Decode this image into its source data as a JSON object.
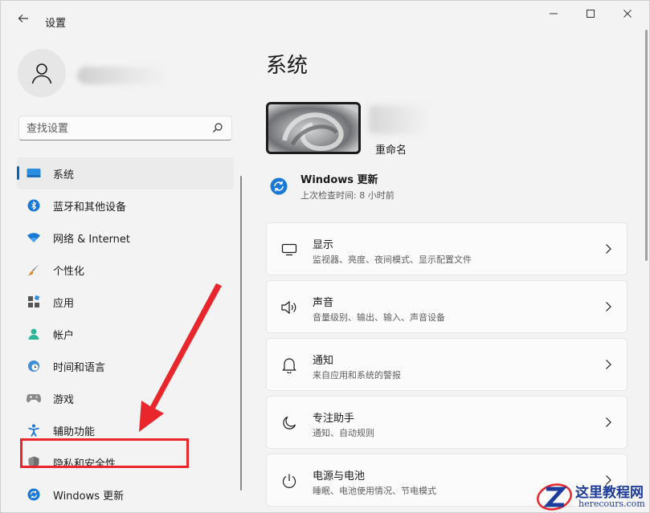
{
  "app": {
    "title": "设置",
    "back_icon": "back-arrow-icon",
    "controls": {
      "minimize": "minimize-icon",
      "maximize": "maximize-icon",
      "close": "close-icon"
    }
  },
  "sidebar": {
    "search_placeholder": "查找设置",
    "items": [
      {
        "label": "系统",
        "icon": "monitor-icon",
        "selected": true
      },
      {
        "label": "蓝牙和其他设备",
        "icon": "bluetooth-icon"
      },
      {
        "label": "网络 & Internet",
        "icon": "wifi-icon"
      },
      {
        "label": "个性化",
        "icon": "brush-icon"
      },
      {
        "label": "应用",
        "icon": "apps-icon"
      },
      {
        "label": "帐户",
        "icon": "account-icon"
      },
      {
        "label": "时间和语言",
        "icon": "globe-clock-icon"
      },
      {
        "label": "游戏",
        "icon": "gamepad-icon"
      },
      {
        "label": "辅助功能",
        "icon": "accessibility-icon"
      },
      {
        "label": "隐私和安全性",
        "icon": "shield-icon"
      },
      {
        "label": "Windows 更新",
        "icon": "windows-update-icon"
      }
    ]
  },
  "main": {
    "page_title": "系统",
    "device": {
      "rename_label": "重命名"
    },
    "windows_update": {
      "title": "Windows 更新",
      "subtitle": "上次检查时间: 8 小时前"
    },
    "cards": [
      {
        "title": "显示",
        "subtitle": "监视器、亮度、夜间模式、显示配置文件",
        "icon": "display-icon"
      },
      {
        "title": "声音",
        "subtitle": "音量级别、输出、输入、声音设备",
        "icon": "speaker-icon"
      },
      {
        "title": "通知",
        "subtitle": "来自应用和系统的警报",
        "icon": "bell-icon"
      },
      {
        "title": "专注助手",
        "subtitle": "通知、自动规则",
        "icon": "moon-icon"
      },
      {
        "title": "电源与电池",
        "subtitle": "睡眠、电池使用情况、节电模式",
        "icon": "power-icon"
      }
    ]
  },
  "colors": {
    "accent": "#0067c0",
    "annotation": "#e8262b",
    "watermark": "#1e3c9b"
  },
  "watermark": {
    "name": "这里教程网",
    "url": "herecours.com"
  }
}
